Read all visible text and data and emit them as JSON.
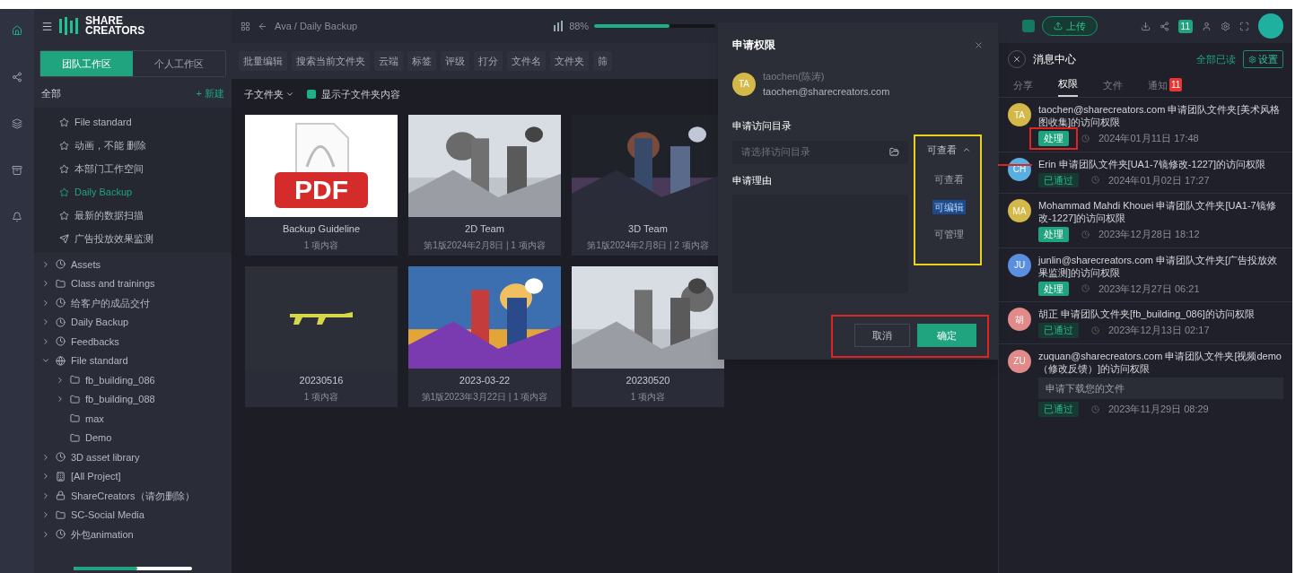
{
  "logo": {
    "line1": "SHARE",
    "line2": "CREATORS"
  },
  "workspace_tabs": [
    {
      "label": "团队工作区",
      "selected": true
    },
    {
      "label": "个人工作区",
      "selected": false
    }
  ],
  "sidebar": {
    "heading": "全部",
    "new_label": "+ 新建",
    "pinned": [
      {
        "label": "File standard",
        "selected": false,
        "kind": "star"
      },
      {
        "label": "动画，不能 删除",
        "selected": false,
        "kind": "star"
      },
      {
        "label": "本部门工作空间",
        "selected": false,
        "kind": "star"
      },
      {
        "label": "Daily Backup",
        "selected": true,
        "kind": "star"
      },
      {
        "label": "最新的数据扫描",
        "selected": false,
        "kind": "star"
      },
      {
        "label": "广告投放效果监测",
        "selected": false,
        "kind": "send"
      }
    ],
    "tree": [
      {
        "label": "Assets",
        "kind": "clock",
        "expanded": false
      },
      {
        "label": "Class and trainings",
        "kind": "folder",
        "expanded": false
      },
      {
        "label": "给客户的成品交付",
        "kind": "clock",
        "expanded": false
      },
      {
        "label": "Daily Backup",
        "kind": "clock",
        "expanded": false
      },
      {
        "label": "Feedbacks",
        "kind": "clock",
        "expanded": false
      },
      {
        "label": "File standard",
        "kind": "globe",
        "expanded": true,
        "children": [
          {
            "label": "fb_building_086",
            "kind": "folder",
            "expanded": false
          },
          {
            "label": "fb_building_088",
            "kind": "folder",
            "expanded": false
          },
          {
            "label": "max",
            "kind": "folder"
          },
          {
            "label": "Demo",
            "kind": "folder"
          }
        ]
      },
      {
        "label": "3D asset library",
        "kind": "clock",
        "expanded": false
      },
      {
        "label": "[All Project]",
        "kind": "building",
        "expanded": false
      },
      {
        "label": "ShareCreators（请勿删除）",
        "kind": "lock",
        "expanded": false
      },
      {
        "label": "SC-Social Media",
        "kind": "folder",
        "expanded": false
      },
      {
        "label": "外包animation",
        "kind": "clock",
        "expanded": false
      }
    ]
  },
  "header": {
    "breadcrumb": "Ava / Daily Backup",
    "zoom": "88%",
    "zoom_slider": {
      "level": 0.62
    },
    "upload": "上传",
    "notification_count": "11"
  },
  "toolbar": [
    "批量编辑",
    "搜索当前文件夹",
    "云端",
    "标签",
    "评级",
    "打分",
    "文件名",
    "文件夹",
    "筛"
  ],
  "subbar": {
    "subfolder": "子文件夹",
    "show_subfolder_content": {
      "label": "显示子文件夹内容",
      "checked": true
    }
  },
  "files": [
    {
      "name": "Backup Guideline",
      "meta": "1 项内容",
      "kind": "pdf",
      "badge": "PDF"
    },
    {
      "name": "2D Team",
      "meta": "第1版2024年2月8日 | 1 项内容",
      "kind": "picture"
    },
    {
      "name": "3D Team",
      "meta": "第1版2024年2月8日 | 2 项内容",
      "kind": "picture"
    },
    {
      "name": "20230516",
      "meta": "1 项内容",
      "kind": "gun"
    },
    {
      "name": "2023-03-22",
      "meta": "第1版2023年3月22日 | 1 项内容",
      "kind": "picture"
    },
    {
      "name": "20230520",
      "meta": "1 项内容",
      "kind": "picture"
    }
  ],
  "dialog": {
    "title": "申请权限",
    "user_name": "taochen(陈涛)",
    "user_email": "taochen@sharecreators.com",
    "avatar": "TA",
    "dir_label": "申请访问目录",
    "dir_placeholder": "请选择访问目录",
    "permission": "可查看",
    "options": [
      {
        "label": "可查看",
        "selected": false
      },
      {
        "label": "可编辑",
        "selected": true
      },
      {
        "label": "可管理",
        "selected": false
      }
    ],
    "reason_label": "申请理由",
    "cancel": "取消",
    "confirm": "确定"
  },
  "messages_panel": {
    "title": "消息中心",
    "mark_all_read": "全部已读",
    "settings": "设置",
    "tabs": [
      {
        "label": "分享",
        "selected": false
      },
      {
        "label": "权限",
        "selected": true
      },
      {
        "label": "文件",
        "selected": false
      },
      {
        "label": "通知",
        "selected": false,
        "badge": "11"
      }
    ],
    "items": [
      {
        "avatar": "TA",
        "color": "#d4b84a",
        "text": "taochen@sharecreators.com 申请团队文件夹[美术风格图收集]的访问权限",
        "tag": "处理",
        "done": false,
        "time": "2024年01月11日 17:48"
      },
      {
        "avatar": "CH",
        "color": "#5aaee0",
        "text": "Erin 申请团队文件夹[UA1-7镜修改-1227]的访问权限",
        "tag": "已通过",
        "done": true,
        "time": "2024年01月02日 17:27"
      },
      {
        "avatar": "MA",
        "color": "#d4b84a",
        "text": "Mohammad Mahdi Khouei 申请团队文件夹[UA1-7镜修改-1227]的访问权限",
        "tag": "处理",
        "done": false,
        "time": "2023年12月28日 18:12"
      },
      {
        "avatar": "JU",
        "color": "#5a8ee0",
        "text": "junlin@sharecreators.com 申请团队文件夹[广告投放效果监测]的访问权限",
        "tag": "处理",
        "done": false,
        "time": "2023年12月27日 06:21"
      },
      {
        "avatar": "胡",
        "color": "#e08a8a",
        "text": "胡正 申请团队文件夹[fb_building_086]的访问权限",
        "tag": "已通过",
        "done": true,
        "time": "2023年12月13日 02:17"
      },
      {
        "avatar": "ZU",
        "color": "#e08a8a",
        "text": "zuquan@sharecreators.com 申请团队文件夹[视频demo（修改反馈）]的访问权限",
        "reason": "申请下载您的文件",
        "tag": "已通过",
        "done": true,
        "time": "2023年11月29日 08:29"
      }
    ]
  }
}
